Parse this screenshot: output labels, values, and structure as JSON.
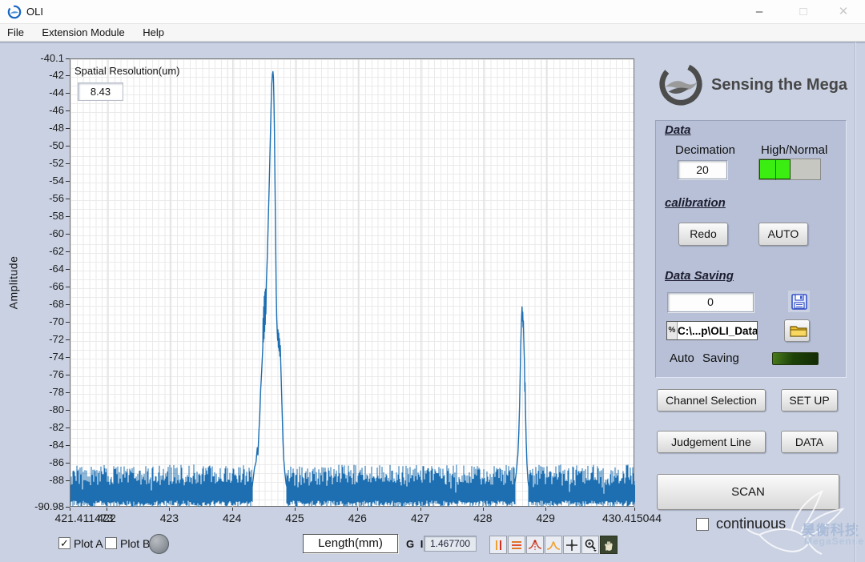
{
  "window": {
    "title": "OLI"
  },
  "icons": {
    "minimize": "–",
    "maximize": "□",
    "close": "✕",
    "check": "✓"
  },
  "menu": {
    "items": [
      "File",
      "Extension Module",
      "Help"
    ]
  },
  "plot": {
    "spatial_resolution_label": "Spatial Resolution(um)",
    "spatial_resolution_value": "8.43",
    "amplitude_label": "Amplitude"
  },
  "chart_data": {
    "type": "line",
    "title": "",
    "xlabel": "Length(mm)",
    "ylabel": "Amplitude",
    "xlim": [
      421.411473,
      430.415044
    ],
    "ylim": [
      -90.98,
      -40.1
    ],
    "grid": true,
    "line_color": "#1d6fb2",
    "x_ticks": [
      {
        "v": 421.411473,
        "label": "421.411473"
      },
      {
        "v": 422,
        "label": "422"
      },
      {
        "v": 423,
        "label": "423"
      },
      {
        "v": 424,
        "label": "424"
      },
      {
        "v": 425,
        "label": "425"
      },
      {
        "v": 426,
        "label": "426"
      },
      {
        "v": 427,
        "label": "427"
      },
      {
        "v": 428,
        "label": "428"
      },
      {
        "v": 429,
        "label": "429"
      },
      {
        "v": 430.415044,
        "label": "430.415044"
      }
    ],
    "y_ticks": [
      {
        "v": -40.1,
        "label": "-40.1"
      },
      {
        "v": -42,
        "label": "-42"
      },
      {
        "v": -44,
        "label": "-44"
      },
      {
        "v": -46,
        "label": "-46"
      },
      {
        "v": -48,
        "label": "-48"
      },
      {
        "v": -50,
        "label": "-50"
      },
      {
        "v": -52,
        "label": "-52"
      },
      {
        "v": -54,
        "label": "-54"
      },
      {
        "v": -56,
        "label": "-56"
      },
      {
        "v": -58,
        "label": "-58"
      },
      {
        "v": -60,
        "label": "-60"
      },
      {
        "v": -62,
        "label": "-62"
      },
      {
        "v": -64,
        "label": "-64"
      },
      {
        "v": -66,
        "label": "-66"
      },
      {
        "v": -68,
        "label": "-68"
      },
      {
        "v": -70,
        "label": "-70"
      },
      {
        "v": -72,
        "label": "-72"
      },
      {
        "v": -74,
        "label": "-74"
      },
      {
        "v": -76,
        "label": "-76"
      },
      {
        "v": -78,
        "label": "-78"
      },
      {
        "v": -80,
        "label": "-80"
      },
      {
        "v": -82,
        "label": "-82"
      },
      {
        "v": -84,
        "label": "-84"
      },
      {
        "v": -86,
        "label": "-86"
      },
      {
        "v": -88,
        "label": "-88"
      },
      {
        "v": -90.98,
        "label": "-90.98"
      }
    ],
    "noise_floor": {
      "mean": -89.2,
      "typical_top": -87.5,
      "spike_top": -85.2,
      "bottom": -90.9
    },
    "series": [
      {
        "name": "main-reflection-peak",
        "points": [
          [
            424.31,
            -88.6
          ],
          [
            424.345,
            -86.5
          ],
          [
            424.37,
            -85.8
          ],
          [
            424.39,
            -84.2
          ],
          [
            424.4,
            -85.0
          ],
          [
            424.415,
            -82.5
          ],
          [
            424.43,
            -80.5
          ],
          [
            424.445,
            -77.5
          ],
          [
            424.46,
            -75.5
          ],
          [
            424.47,
            -74.0
          ],
          [
            424.478,
            -72.8
          ],
          [
            424.483,
            -69.5
          ],
          [
            424.487,
            -72.2
          ],
          [
            424.492,
            -68.2
          ],
          [
            424.497,
            -71.8
          ],
          [
            424.502,
            -67.0
          ],
          [
            424.507,
            -71.0
          ],
          [
            424.512,
            -66.5
          ],
          [
            424.517,
            -70.2
          ],
          [
            424.522,
            -66.2
          ],
          [
            424.527,
            -69.0
          ],
          [
            424.535,
            -65.5
          ],
          [
            424.55,
            -62.5
          ],
          [
            424.565,
            -58.5
          ],
          [
            424.58,
            -54.5
          ],
          [
            424.595,
            -50.0
          ],
          [
            424.61,
            -45.5
          ],
          [
            424.62,
            -43.0
          ],
          [
            424.632,
            -41.8
          ],
          [
            424.64,
            -41.5
          ],
          [
            424.648,
            -42.2
          ],
          [
            424.655,
            -44.5
          ],
          [
            424.663,
            -48.0
          ],
          [
            424.67,
            -52.5
          ],
          [
            424.678,
            -57.5
          ],
          [
            424.685,
            -62.0
          ],
          [
            424.692,
            -66.5
          ],
          [
            424.7,
            -69.5
          ],
          [
            424.708,
            -71.0
          ],
          [
            424.715,
            -72.0
          ],
          [
            424.72,
            -70.8
          ],
          [
            424.726,
            -72.8
          ],
          [
            424.732,
            -71.2
          ],
          [
            424.738,
            -73.2
          ],
          [
            424.744,
            -71.8
          ],
          [
            424.75,
            -73.8
          ],
          [
            424.757,
            -72.6
          ],
          [
            424.764,
            -74.5
          ],
          [
            424.772,
            -76.5
          ],
          [
            424.78,
            -78.5
          ],
          [
            424.79,
            -81.0
          ],
          [
            424.8,
            -83.5
          ],
          [
            424.812,
            -85.5
          ],
          [
            424.83,
            -87.0
          ],
          [
            424.85,
            -88.3
          ],
          [
            424.87,
            -88.8
          ]
        ]
      },
      {
        "name": "secondary-reflection-peak",
        "points": [
          [
            428.49,
            -88.6
          ],
          [
            428.52,
            -87.0
          ],
          [
            428.545,
            -85.0
          ],
          [
            428.56,
            -82.5
          ],
          [
            428.572,
            -79.5
          ],
          [
            428.582,
            -76.0
          ],
          [
            428.59,
            -73.0
          ],
          [
            428.598,
            -70.8
          ],
          [
            428.605,
            -69.3
          ],
          [
            428.612,
            -68.2
          ],
          [
            428.618,
            -69.8
          ],
          [
            428.623,
            -68.8
          ],
          [
            428.628,
            -70.5
          ],
          [
            428.633,
            -69.8
          ],
          [
            428.638,
            -71.5
          ],
          [
            428.643,
            -72.8
          ],
          [
            428.648,
            -74.0
          ],
          [
            428.652,
            -75.5
          ],
          [
            428.656,
            -77.8
          ],
          [
            428.66,
            -76.8
          ],
          [
            428.664,
            -78.8
          ],
          [
            428.67,
            -81.0
          ],
          [
            428.678,
            -83.5
          ],
          [
            428.69,
            -86.0
          ],
          [
            428.705,
            -87.8
          ],
          [
            428.72,
            -88.7
          ]
        ]
      }
    ]
  },
  "bottom_bar": {
    "plot_a_label": "Plot A",
    "plot_a_checked": true,
    "plot_b_label": "Plot B",
    "plot_b_checked": false,
    "length_selector": "Length(mm)",
    "gi_label": "G I",
    "gi_value": "1.467700",
    "palette_icons": [
      "vertical-cursors",
      "horizontal-cursors",
      "peak-cursor",
      "peak-search",
      "crosshair",
      "zoom",
      "pan"
    ]
  },
  "right_panel": {
    "brand_tagline": "Sensing the Mega",
    "data_section": {
      "title": "Data",
      "decimation_label": "Decimation",
      "decimation_value": "20",
      "mode_label": "High/Normal"
    },
    "calibration_section": {
      "title": "calibration",
      "redo_button": "Redo",
      "auto_button": "AUTO"
    },
    "data_saving_section": {
      "title": "Data Saving",
      "counter_value": "0",
      "path_value": "C:\\...p\\OLI_Data",
      "auto_saving_label": "Auto Saving"
    },
    "buttons": {
      "channel_selection": "Channel Selection",
      "setup": "SET UP",
      "judgement_line": "Judgement Line",
      "data": "DATA",
      "scan": "SCAN"
    },
    "continuous_label": "continuous",
    "watermark": {
      "cn": "昊衡科技",
      "en": "MegaSense"
    }
  },
  "colors": {
    "panel_bg": "#c9d1e2",
    "subpanel_bg": "#b7c0d6",
    "plot_line": "#1d6fb2",
    "slider_green": "#3ced12",
    "led_green_dark": "#1d4208",
    "accent_text": "#1c1c30"
  }
}
